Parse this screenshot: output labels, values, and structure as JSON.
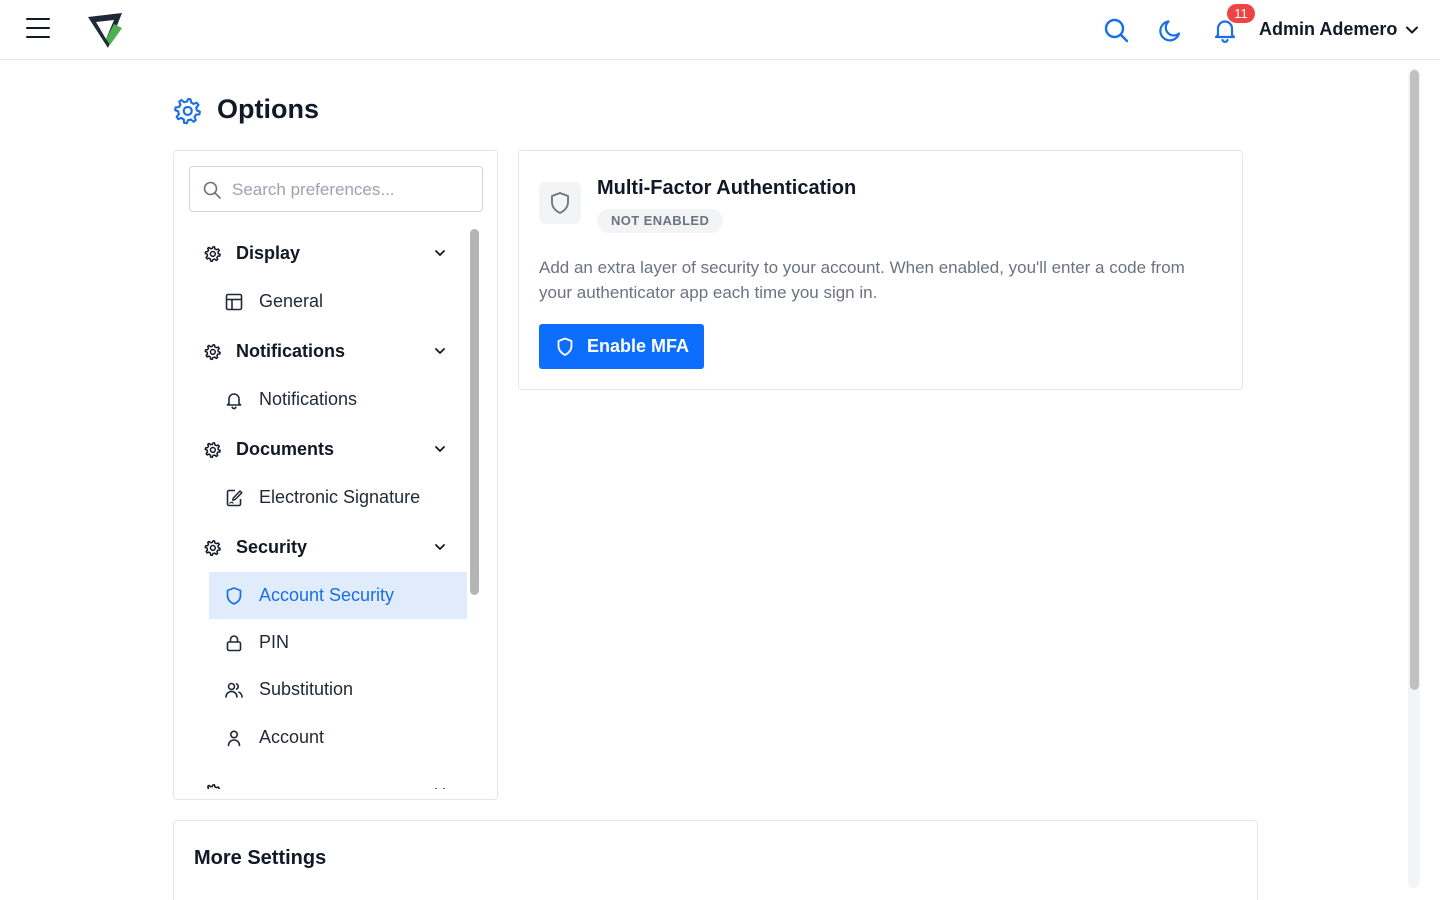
{
  "header": {
    "user_name": "Admin Ademero",
    "notification_count": "11",
    "icons": [
      "menu-icon",
      "logo",
      "search-icon",
      "moon-icon",
      "bell-icon",
      "chevron-down-icon"
    ]
  },
  "page": {
    "title": "Options"
  },
  "sidebar": {
    "search_placeholder": "Search preferences...",
    "groups": [
      {
        "label": "Display",
        "items": [
          {
            "label": "General",
            "icon": "layout-icon"
          }
        ]
      },
      {
        "label": "Notifications",
        "items": [
          {
            "label": "Notifications",
            "icon": "bell-icon"
          }
        ]
      },
      {
        "label": "Documents",
        "items": [
          {
            "label": "Electronic Signature",
            "icon": "signature-icon"
          }
        ]
      },
      {
        "label": "Security",
        "items": [
          {
            "label": "Account Security",
            "icon": "shield-icon",
            "active": true
          },
          {
            "label": "PIN",
            "icon": "lock-icon"
          },
          {
            "label": "Substitution",
            "icon": "users-icon"
          },
          {
            "label": "Account",
            "icon": "user-icon"
          }
        ]
      }
    ]
  },
  "mfa": {
    "title": "Multi-Factor Authentication",
    "status": "NOT ENABLED",
    "description": "Add an extra layer of security to your account. When enabled, you'll enter a code from your authenticator app each time you sign in.",
    "button_label": "Enable MFA"
  },
  "more_settings": {
    "title": "More Settings"
  },
  "colors": {
    "accent": "#0d6efd",
    "active_bg": "#e0ecfc",
    "badge": "#ef4444"
  }
}
